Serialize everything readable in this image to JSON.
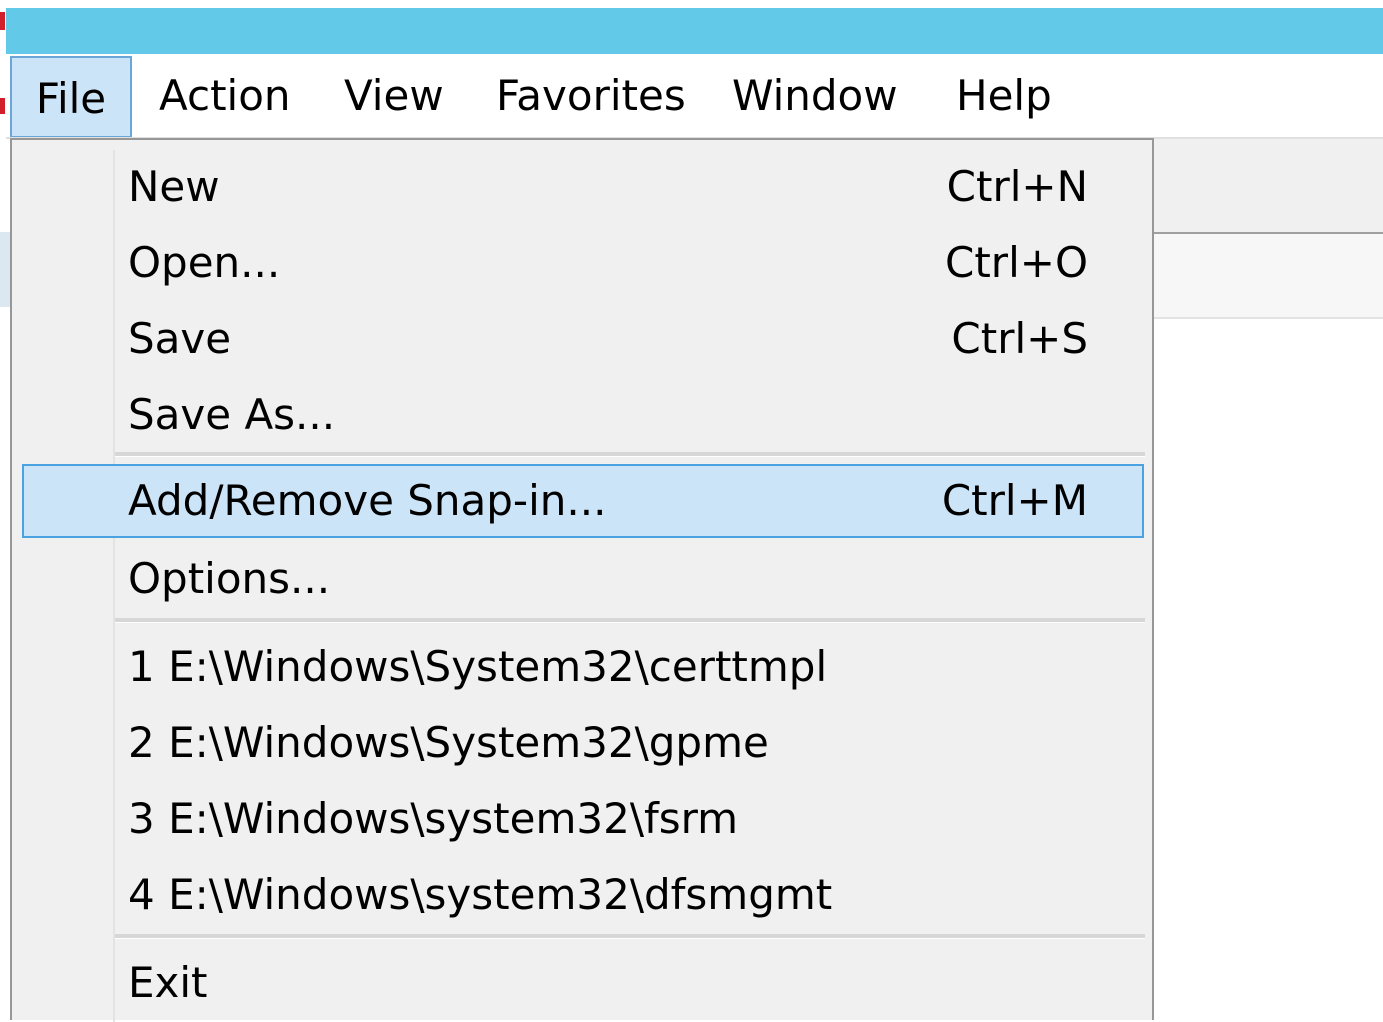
{
  "colors": {
    "titlebar": "#63c9e9",
    "menu_background": "#f0f0f0",
    "highlight_background": "#cce4f7",
    "highlight_border": "#4aa2e0"
  },
  "menubar": {
    "items": [
      {
        "label": "File",
        "active": true
      },
      {
        "label": "Action"
      },
      {
        "label": "View"
      },
      {
        "label": "Favorites"
      },
      {
        "label": "Window"
      },
      {
        "label": "Help"
      }
    ]
  },
  "file_menu": {
    "groups": [
      {
        "items": [
          {
            "label": "New",
            "shortcut": "Ctrl+N"
          },
          {
            "label": "Open...",
            "shortcut": "Ctrl+O"
          },
          {
            "label": "Save",
            "shortcut": "Ctrl+S"
          },
          {
            "label": "Save As...",
            "shortcut": ""
          }
        ]
      },
      {
        "items": [
          {
            "label": "Add/Remove Snap-in...",
            "shortcut": "Ctrl+M",
            "highlighted": true
          },
          {
            "label": "Options...",
            "shortcut": ""
          }
        ]
      },
      {
        "items": [
          {
            "label": "1 E:\\Windows\\System32\\certtmpl",
            "shortcut": ""
          },
          {
            "label": "2 E:\\Windows\\System32\\gpme",
            "shortcut": ""
          },
          {
            "label": "3 E:\\Windows\\system32\\fsrm",
            "shortcut": ""
          },
          {
            "label": "4 E:\\Windows\\system32\\dfsmgmt",
            "shortcut": ""
          }
        ]
      },
      {
        "items": [
          {
            "label": "Exit",
            "shortcut": ""
          }
        ]
      }
    ]
  }
}
